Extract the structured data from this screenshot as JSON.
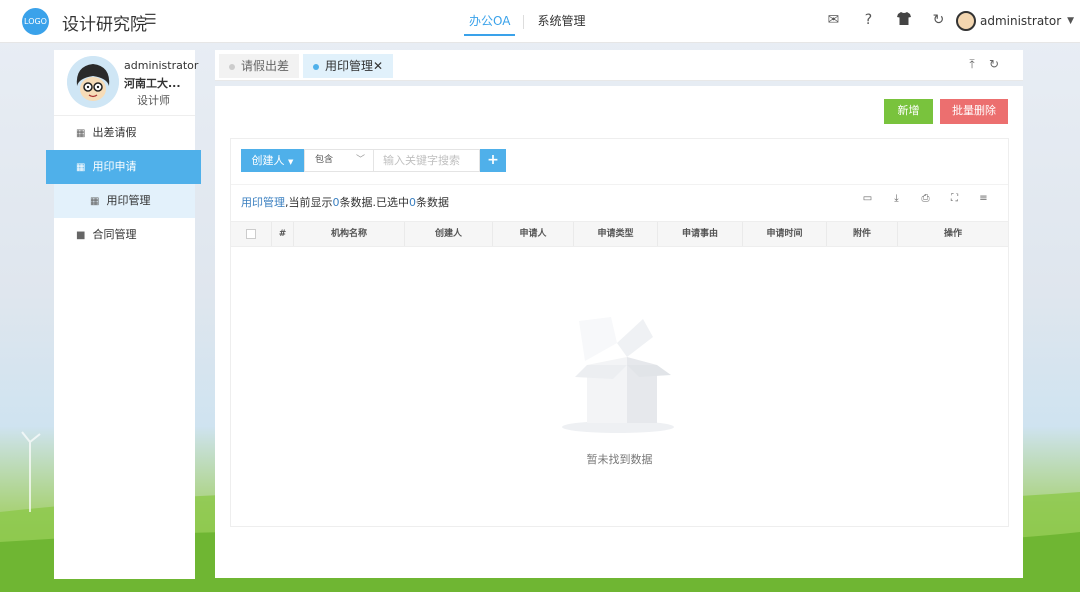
{
  "header": {
    "logo_text": "LOGO",
    "title": "设计研究院",
    "nav": [
      {
        "label": "办公OA",
        "active": true
      },
      {
        "label": "系统管理",
        "active": false
      }
    ],
    "icons": [
      "mail-icon",
      "help-icon",
      "shirt-icon",
      "refresh-icon"
    ],
    "user": "administrator"
  },
  "sidebar": {
    "profile": {
      "name": "administrator",
      "org": "河南工大...",
      "role": "设计师"
    },
    "items": [
      {
        "label": "出差请假",
        "icon": "grid-icon"
      },
      {
        "label": "用印申请",
        "icon": "grid-icon",
        "active": true
      },
      {
        "label": "用印管理",
        "icon": "grid-icon",
        "sub": true
      },
      {
        "label": "合同管理",
        "icon": "gift-icon"
      }
    ]
  },
  "tabs": [
    {
      "label": "请假出差",
      "active": false
    },
    {
      "label": "用印管理",
      "active": true,
      "close": "✕"
    }
  ],
  "toolbar": {
    "add_label": "新增",
    "batch_delete_label": "批量删除"
  },
  "search": {
    "field_label": "创建人",
    "operator": "包含",
    "placeholder": "输入关键字搜索"
  },
  "info": {
    "module": "用印管理",
    "text_a": ",当前显示",
    "shown_count": "0",
    "text_b": "条数据.已选中",
    "selected_count": "0",
    "text_c": "条数据"
  },
  "table": {
    "columns": [
      "#",
      "机构名称",
      "创建人",
      "申请人",
      "申请类型",
      "申请事由",
      "申请时间",
      "附件",
      "操作"
    ],
    "rows": [],
    "empty_text": "暂未找到数据"
  },
  "colors": {
    "accent": "#4fb0ea",
    "add": "#79c33d",
    "delete": "#ec6f6f"
  }
}
